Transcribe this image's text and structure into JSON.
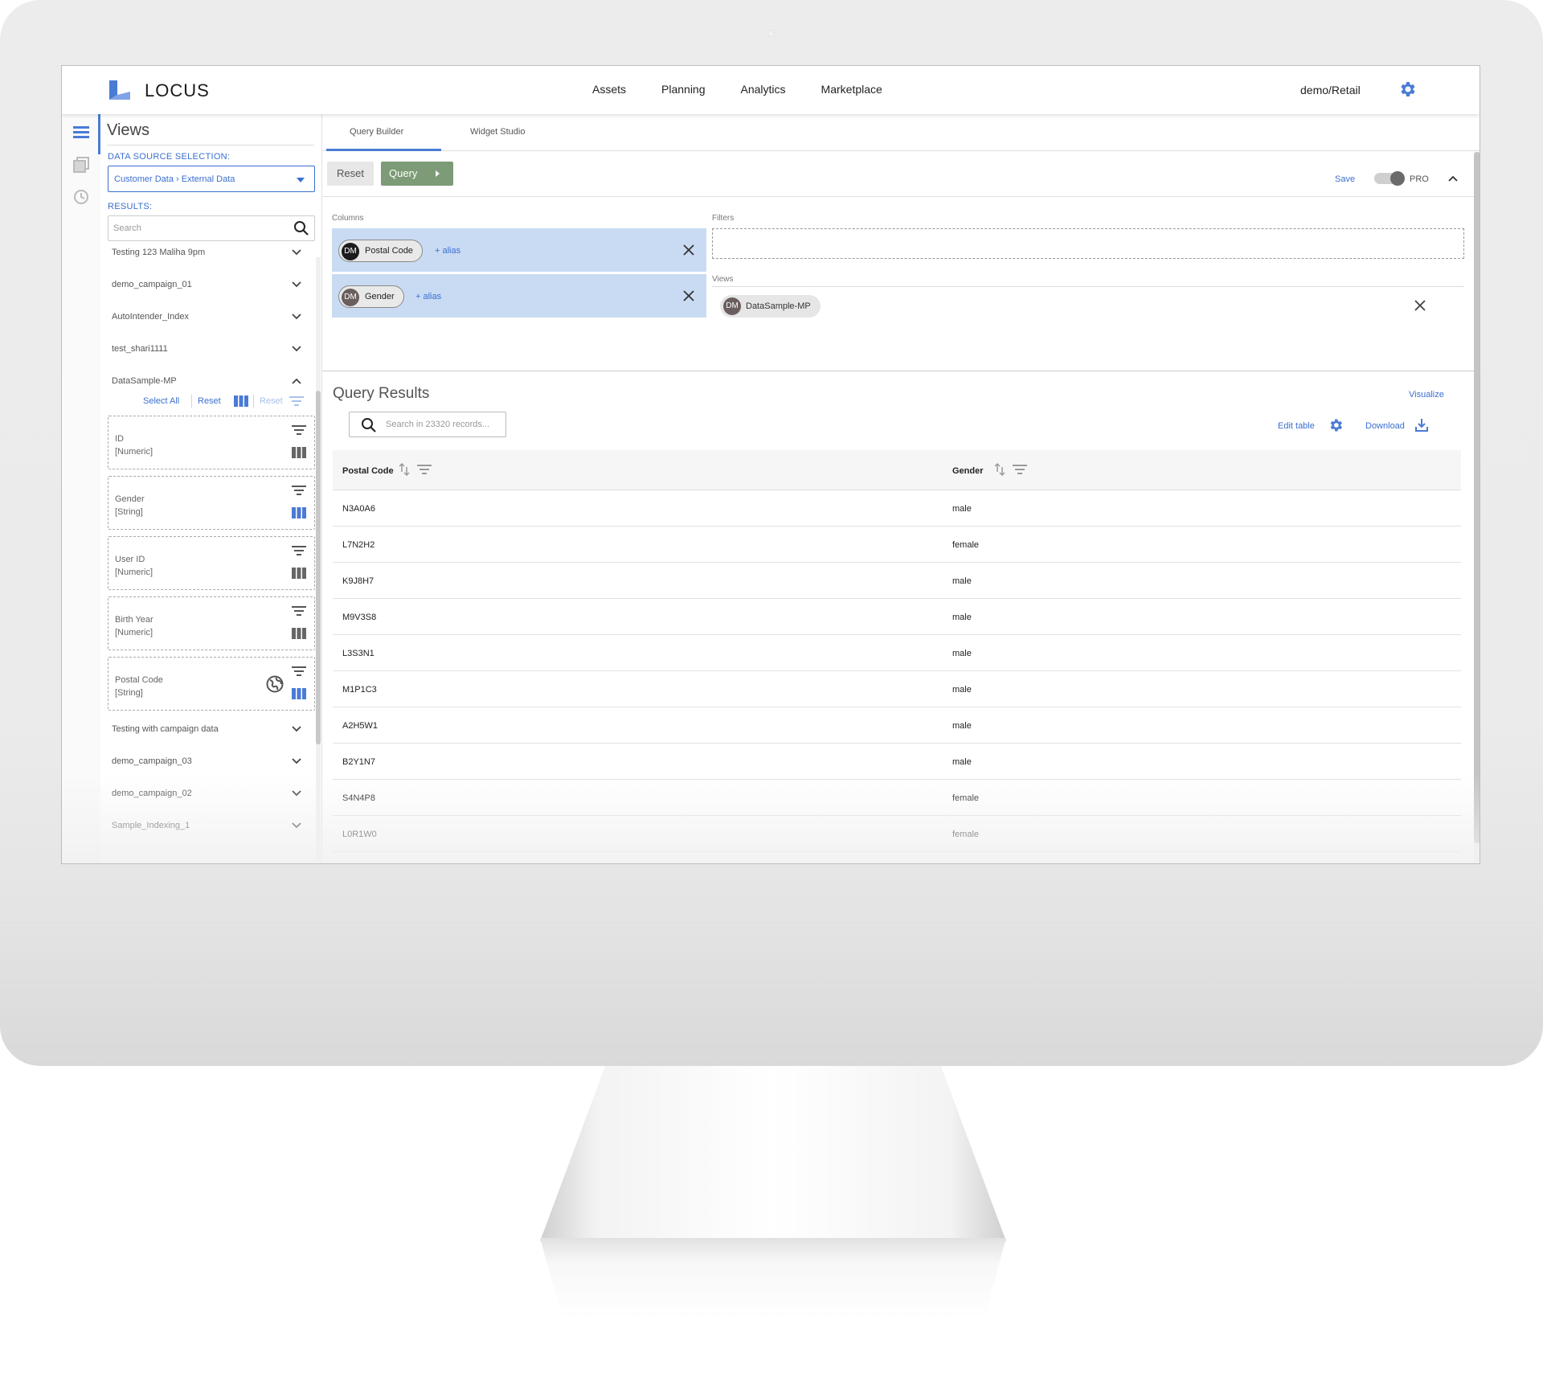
{
  "app": {
    "logo_text": "LOCUS",
    "account": "demo/Retail",
    "accent_color": "#4a7bd5",
    "nav": [
      "Assets",
      "Planning",
      "Analytics",
      "Marketplace"
    ]
  },
  "sidebar": {
    "title": "Views",
    "data_source_label": "DATA SOURCE SELECTION:",
    "data_source_value": "Customer Data › External Data",
    "results_label": "RESULTS:",
    "search_placeholder": "Search",
    "items_top": [
      "Testing 123 Maliha 9pm",
      "demo_campaign_01",
      "AutoIntender_Index",
      "test_shari1111"
    ],
    "expanded_item": "DataSample-MP",
    "toolbar": {
      "select_all": "Select All",
      "reset": "Reset",
      "reset_disabled": "Reset"
    },
    "fields": [
      {
        "name": "ID",
        "type": "[Numeric]",
        "selected": false
      },
      {
        "name": "Gender",
        "type": "[String]",
        "selected": true
      },
      {
        "name": "User ID",
        "type": "[Numeric]",
        "selected": false
      },
      {
        "name": "Birth Year",
        "type": "[Numeric]",
        "selected": false
      },
      {
        "name": "Postal Code",
        "type": "[String]",
        "selected": true
      }
    ],
    "items_bottom": [
      "Testing with campaign data",
      "demo_campaign_03",
      "demo_campaign_02",
      "Sample_Indexing_1"
    ]
  },
  "tabs": [
    "Query Builder",
    "Widget Studio"
  ],
  "query": {
    "reset_label": "Reset",
    "query_label": "Query",
    "save_label": "Save",
    "pro_label": "PRO",
    "columns_label": "Columns",
    "filters_label": "Filters",
    "views_label": "Views",
    "columns": [
      {
        "avatar": "DM",
        "name": "Postal Code",
        "alias": "+ alias"
      },
      {
        "avatar": "DM",
        "name": "Gender",
        "alias": "+ alias"
      }
    ],
    "view": {
      "avatar": "DM",
      "name": "DataSample-MP"
    }
  },
  "results": {
    "title": "Query Results",
    "visualize_label": "Visualize",
    "search_placeholder": "Search in 23320 records...",
    "edit_table_label": "Edit table",
    "download_label": "Download",
    "headers": [
      "Postal Code",
      "Gender"
    ],
    "rows": [
      [
        "N3A0A6",
        "male"
      ],
      [
        "L7N2H2",
        "female"
      ],
      [
        "K9J8H7",
        "male"
      ],
      [
        "M9V3S8",
        "male"
      ],
      [
        "L3S3N1",
        "male"
      ],
      [
        "M1P1C3",
        "male"
      ],
      [
        "A2H5W1",
        "male"
      ],
      [
        "B2Y1N7",
        "male"
      ],
      [
        "S4N4P8",
        "female"
      ],
      [
        "L0R1W0",
        "female"
      ]
    ]
  }
}
